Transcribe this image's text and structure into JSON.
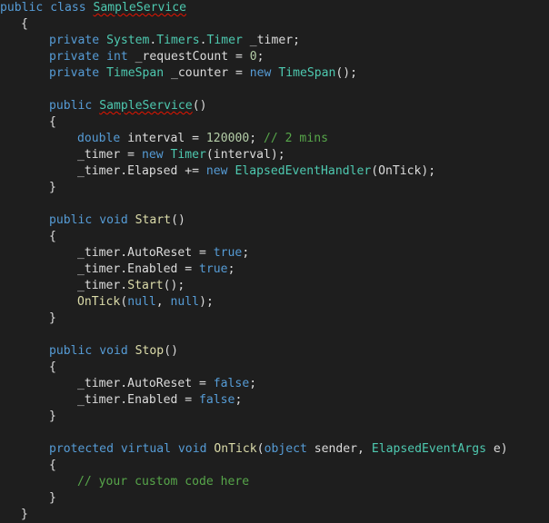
{
  "editor": {
    "language": "C#",
    "colors": {
      "background": "#1e1e1e",
      "keyword": "#569cd6",
      "type": "#4ec9b0",
      "method": "#dcdcaa",
      "number": "#b5cea8",
      "comment": "#57a64a",
      "identifier": "#dcdcdc",
      "error_squiggle": "#e51400"
    },
    "lines": [
      {
        "indent": 0,
        "tokens": [
          [
            "kw",
            "public"
          ],
          [
            "p",
            " "
          ],
          [
            "kw",
            "class"
          ],
          [
            "p",
            " "
          ],
          [
            "type-err",
            "SampleService"
          ]
        ]
      },
      {
        "indent": 1,
        "tokens": [
          [
            "p",
            "{"
          ]
        ]
      },
      {
        "indent": 2,
        "tokens": [
          [
            "kw",
            "private"
          ],
          [
            "p",
            " "
          ],
          [
            "type",
            "System"
          ],
          [
            "p",
            "."
          ],
          [
            "type",
            "Timers"
          ],
          [
            "p",
            "."
          ],
          [
            "type",
            "Timer"
          ],
          [
            "p",
            " _timer;"
          ]
        ]
      },
      {
        "indent": 2,
        "tokens": [
          [
            "kw",
            "private"
          ],
          [
            "p",
            " "
          ],
          [
            "kw",
            "int"
          ],
          [
            "p",
            " _requestCount = "
          ],
          [
            "num",
            "0"
          ],
          [
            "p",
            ";"
          ]
        ]
      },
      {
        "indent": 2,
        "tokens": [
          [
            "kw",
            "private"
          ],
          [
            "p",
            " "
          ],
          [
            "type",
            "TimeSpan"
          ],
          [
            "p",
            " _counter = "
          ],
          [
            "kw",
            "new"
          ],
          [
            "p",
            " "
          ],
          [
            "type",
            "TimeSpan"
          ],
          [
            "p",
            "();"
          ]
        ]
      },
      {
        "indent": 0,
        "tokens": []
      },
      {
        "indent": 2,
        "tokens": [
          [
            "kw",
            "public"
          ],
          [
            "p",
            " "
          ],
          [
            "type-err",
            "SampleService"
          ],
          [
            "p",
            "()"
          ]
        ]
      },
      {
        "indent": 2,
        "tokens": [
          [
            "p",
            "{"
          ]
        ]
      },
      {
        "indent": 3,
        "tokens": [
          [
            "kw",
            "double"
          ],
          [
            "p",
            " interval = "
          ],
          [
            "num",
            "120000"
          ],
          [
            "p",
            "; "
          ],
          [
            "comment",
            "// 2 mins"
          ]
        ]
      },
      {
        "indent": 3,
        "tokens": [
          [
            "p",
            "_timer = "
          ],
          [
            "kw",
            "new"
          ],
          [
            "p",
            " "
          ],
          [
            "type",
            "Timer"
          ],
          [
            "p",
            "(interval);"
          ]
        ]
      },
      {
        "indent": 3,
        "tokens": [
          [
            "p",
            "_timer.Elapsed += "
          ],
          [
            "kw",
            "new"
          ],
          [
            "p",
            " "
          ],
          [
            "type",
            "ElapsedEventHandler"
          ],
          [
            "p",
            "(OnTick);"
          ]
        ]
      },
      {
        "indent": 2,
        "tokens": [
          [
            "p",
            "}"
          ]
        ]
      },
      {
        "indent": 0,
        "tokens": []
      },
      {
        "indent": 2,
        "tokens": [
          [
            "kw",
            "public"
          ],
          [
            "p",
            " "
          ],
          [
            "kw",
            "void"
          ],
          [
            "p",
            " "
          ],
          [
            "method",
            "Start"
          ],
          [
            "p",
            "()"
          ]
        ]
      },
      {
        "indent": 2,
        "tokens": [
          [
            "p",
            "{"
          ]
        ]
      },
      {
        "indent": 3,
        "tokens": [
          [
            "p",
            "_timer.AutoReset = "
          ],
          [
            "kw",
            "true"
          ],
          [
            "p",
            ";"
          ]
        ]
      },
      {
        "indent": 3,
        "tokens": [
          [
            "p",
            "_timer.Enabled = "
          ],
          [
            "kw",
            "true"
          ],
          [
            "p",
            ";"
          ]
        ]
      },
      {
        "indent": 3,
        "tokens": [
          [
            "p",
            "_timer."
          ],
          [
            "method",
            "Start"
          ],
          [
            "p",
            "();"
          ]
        ]
      },
      {
        "indent": 3,
        "tokens": [
          [
            "method",
            "OnTick"
          ],
          [
            "p",
            "("
          ],
          [
            "kw",
            "null"
          ],
          [
            "p",
            ", "
          ],
          [
            "kw",
            "null"
          ],
          [
            "p",
            ");"
          ]
        ]
      },
      {
        "indent": 2,
        "tokens": [
          [
            "p",
            "}"
          ]
        ]
      },
      {
        "indent": 0,
        "tokens": []
      },
      {
        "indent": 2,
        "tokens": [
          [
            "kw",
            "public"
          ],
          [
            "p",
            " "
          ],
          [
            "kw",
            "void"
          ],
          [
            "p",
            " "
          ],
          [
            "method",
            "Stop"
          ],
          [
            "p",
            "()"
          ]
        ]
      },
      {
        "indent": 2,
        "tokens": [
          [
            "p",
            "{"
          ]
        ]
      },
      {
        "indent": 3,
        "tokens": [
          [
            "p",
            "_timer.AutoReset = "
          ],
          [
            "kw",
            "false"
          ],
          [
            "p",
            ";"
          ]
        ]
      },
      {
        "indent": 3,
        "tokens": [
          [
            "p",
            "_timer.Enabled = "
          ],
          [
            "kw",
            "false"
          ],
          [
            "p",
            ";"
          ]
        ]
      },
      {
        "indent": 2,
        "tokens": [
          [
            "p",
            "}"
          ]
        ]
      },
      {
        "indent": 0,
        "tokens": []
      },
      {
        "indent": 2,
        "tokens": [
          [
            "kw",
            "protected"
          ],
          [
            "p",
            " "
          ],
          [
            "kw",
            "virtual"
          ],
          [
            "p",
            " "
          ],
          [
            "kw",
            "void"
          ],
          [
            "p",
            " "
          ],
          [
            "method",
            "OnTick"
          ],
          [
            "p",
            "("
          ],
          [
            "kw",
            "object"
          ],
          [
            "p",
            " sender, "
          ],
          [
            "type",
            "ElapsedEventArgs"
          ],
          [
            "p",
            " e)"
          ]
        ]
      },
      {
        "indent": 2,
        "tokens": [
          [
            "p",
            "{"
          ]
        ]
      },
      {
        "indent": 3,
        "tokens": [
          [
            "comment",
            "// your custom code here"
          ]
        ]
      },
      {
        "indent": 2,
        "tokens": [
          [
            "p",
            "}"
          ]
        ]
      },
      {
        "indent": 1,
        "tokens": [
          [
            "p",
            "}"
          ]
        ]
      }
    ]
  }
}
